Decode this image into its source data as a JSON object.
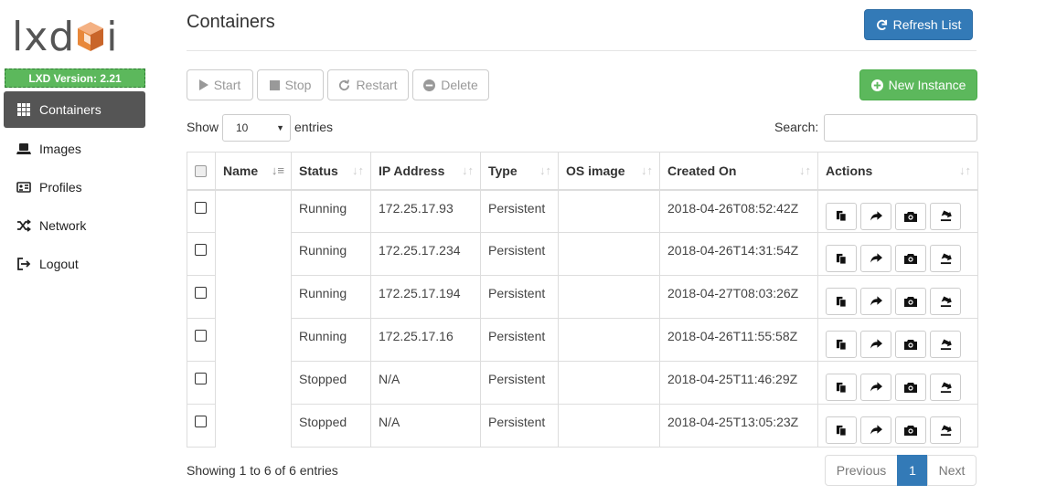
{
  "app": {
    "logo_left": "lxd",
    "logo_right": "i",
    "logo_colors": {
      "text": "#555555",
      "cube": "#e8883a"
    },
    "version": "LXD Version: 2.21"
  },
  "sidebar": {
    "items": [
      {
        "label": "Containers",
        "icon": "grid-icon",
        "active": true
      },
      {
        "label": "Images",
        "icon": "laptop-icon",
        "active": false
      },
      {
        "label": "Profiles",
        "icon": "profile-card-icon",
        "active": false
      },
      {
        "label": "Network",
        "icon": "shuffle-icon",
        "active": false
      },
      {
        "label": "Logout",
        "icon": "logout-icon",
        "active": false
      }
    ]
  },
  "header": {
    "title": "Containers",
    "refresh_label": "Refresh List"
  },
  "toolbar": {
    "start_label": "Start",
    "stop_label": "Stop",
    "restart_label": "Restart",
    "delete_label": "Delete",
    "new_instance_label": "New Instance"
  },
  "listing": {
    "show_label": "Show",
    "page_size": "10",
    "entries_label": "entries",
    "search_label": "Search:",
    "search_value": ""
  },
  "table": {
    "columns": [
      "Name",
      "Status",
      "IP Address",
      "Type",
      "OS image",
      "Created On",
      "Actions"
    ],
    "rows": [
      {
        "name": "",
        "status": "Running",
        "ip": "172.25.17.93",
        "type": "Persistent",
        "os": "",
        "created": "2018-04-26T08:52:42Z"
      },
      {
        "name": "",
        "status": "Running",
        "ip": "172.25.17.234",
        "type": "Persistent",
        "os": "",
        "created": "2018-04-26T14:31:54Z"
      },
      {
        "name": "",
        "status": "Running",
        "ip": "172.25.17.194",
        "type": "Persistent",
        "os": "",
        "created": "2018-04-27T08:03:26Z"
      },
      {
        "name": "",
        "status": "Running",
        "ip": "172.25.17.16",
        "type": "Persistent",
        "os": "",
        "created": "2018-04-26T11:55:58Z"
      },
      {
        "name": "",
        "status": "Stopped",
        "ip": "N/A",
        "type": "Persistent",
        "os": "",
        "created": "2018-04-25T11:46:29Z"
      },
      {
        "name": "",
        "status": "Stopped",
        "ip": "N/A",
        "type": "Persistent",
        "os": "",
        "created": "2018-04-25T13:05:23Z"
      }
    ],
    "row_actions": [
      "copy-icon",
      "share-arrow-icon",
      "camera-icon",
      "export-icon"
    ]
  },
  "footer": {
    "info": "Showing 1 to 6 of 6 entries",
    "prev_label": "Previous",
    "current_page": "1",
    "next_label": "Next"
  },
  "colors": {
    "primary": "#337ab7",
    "success": "#5cb85c",
    "sidebar_active": "#555555"
  }
}
